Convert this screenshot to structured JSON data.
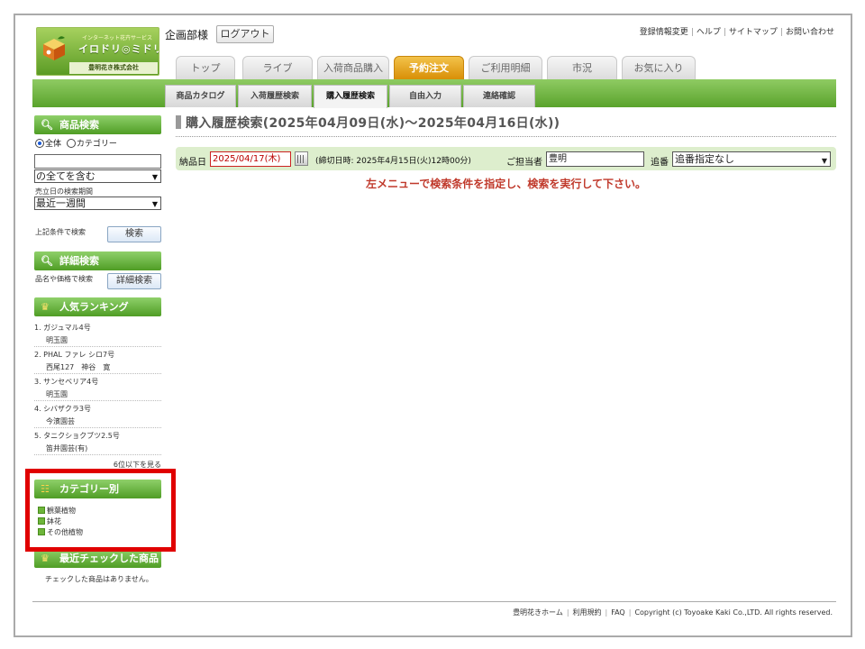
{
  "header": {
    "logo_sub": "インターネット花卉サービス",
    "logo_name": "イロドリ◎ミドリ",
    "logo_company": "豊明花き株式会社",
    "user_name": "企画部様",
    "logout_label": "ログアウト",
    "links": [
      "登録情報変更",
      "ヘルプ",
      "サイトマップ",
      "お問い合わせ"
    ]
  },
  "tabs": [
    {
      "label": "トップ",
      "active": false
    },
    {
      "label": "ライブ",
      "active": false
    },
    {
      "label": "入荷商品購入",
      "active": false
    },
    {
      "label": "予約注文",
      "active": true
    },
    {
      "label": "ご利用明細",
      "active": false
    },
    {
      "label": "市況",
      "active": false
    },
    {
      "label": "お気に入り",
      "active": false
    }
  ],
  "subtabs": [
    {
      "label": "商品カタログ",
      "active": false
    },
    {
      "label": "入荷履歴検索",
      "active": false
    },
    {
      "label": "購入履歴検索",
      "active": true
    },
    {
      "label": "自由入力",
      "active": false
    },
    {
      "label": "連絡確認",
      "active": false
    }
  ],
  "sidebar": {
    "product_search": {
      "title": "商品検索",
      "radio_all": "全体",
      "radio_category": "カテゴリー",
      "match_mode": "の全てを含む",
      "period_label": "売立日の検索期間",
      "period_value": "最近一週間",
      "search_caption": "上記条件で検索",
      "search_button": "検索"
    },
    "detail_search": {
      "title": "詳細検索",
      "caption": "品名や価格で検索",
      "button": "詳細検索"
    },
    "ranking": {
      "title": "人気ランキング",
      "items": [
        {
          "name": "1. ガジュマル4号",
          "shop": "明玉園"
        },
        {
          "name": "2. PHAL ファレ シロ7号",
          "shop": "西尾127　神谷　寛"
        },
        {
          "name": "3. サンセベリア4号",
          "shop": "明玉園"
        },
        {
          "name": "4. シバザクラ3号",
          "shop": "今濱園芸"
        },
        {
          "name": "5. タニクショクブツ2.5号",
          "shop": "笛井園芸(有)"
        }
      ],
      "more": "6位以下を見る"
    },
    "category": {
      "title": "カテゴリー別",
      "items": [
        "観葉植物",
        "鉢花",
        "その他植物"
      ]
    },
    "recent": {
      "title": "最近チェックした商品",
      "empty": "チェックした商品はありません。"
    }
  },
  "main": {
    "title": "購入履歴検索(2025年04月09日(水)～2025年04月16日(水))",
    "delivery_label": "納品日",
    "delivery_date": "2025/04/17(木)",
    "deadline": "(締切日時: 2025年4月15日(火)12時00分)",
    "staff_label": "ご担当者",
    "staff_value": "豊明",
    "seq_label": "追番",
    "seq_value": "追番指定なし",
    "message": "左メニューで検索条件を指定し、検索を実行して下さい。"
  },
  "footer": {
    "links": [
      "豊明花きホーム",
      "利用規約",
      "FAQ"
    ],
    "copyright": "Copyright (c) Toyoake Kaki Co.,LTD. All rights reserved."
  },
  "colors": {
    "accent_green": "#5aa32c",
    "active_tab": "#e8a320",
    "alert_red": "#c0392b",
    "highlight": "#e00000"
  }
}
